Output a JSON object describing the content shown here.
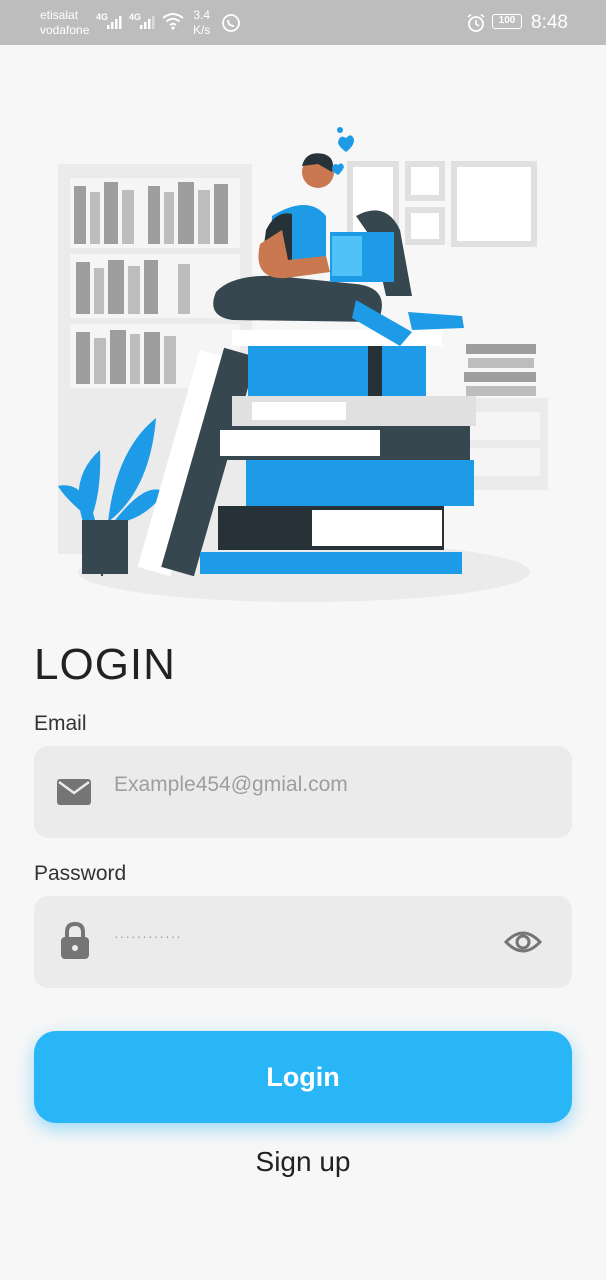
{
  "status_bar": {
    "carrier1": "etisalat",
    "carrier2": "vodafone",
    "net1": "4G",
    "net2": "4G",
    "speed_value": "3.4",
    "speed_unit": "K/s",
    "battery": "100",
    "time": "8:48"
  },
  "login": {
    "title": "LOGIN",
    "email_label": "Email",
    "email_value": "Example454@gmial.com",
    "password_label": "Password",
    "password_value": "············",
    "login_button": "Login",
    "signup_link": "Sign up"
  },
  "colors": {
    "accent": "#29b6f6",
    "illustration_blue": "#1e9be6",
    "dark": "#37474f"
  }
}
